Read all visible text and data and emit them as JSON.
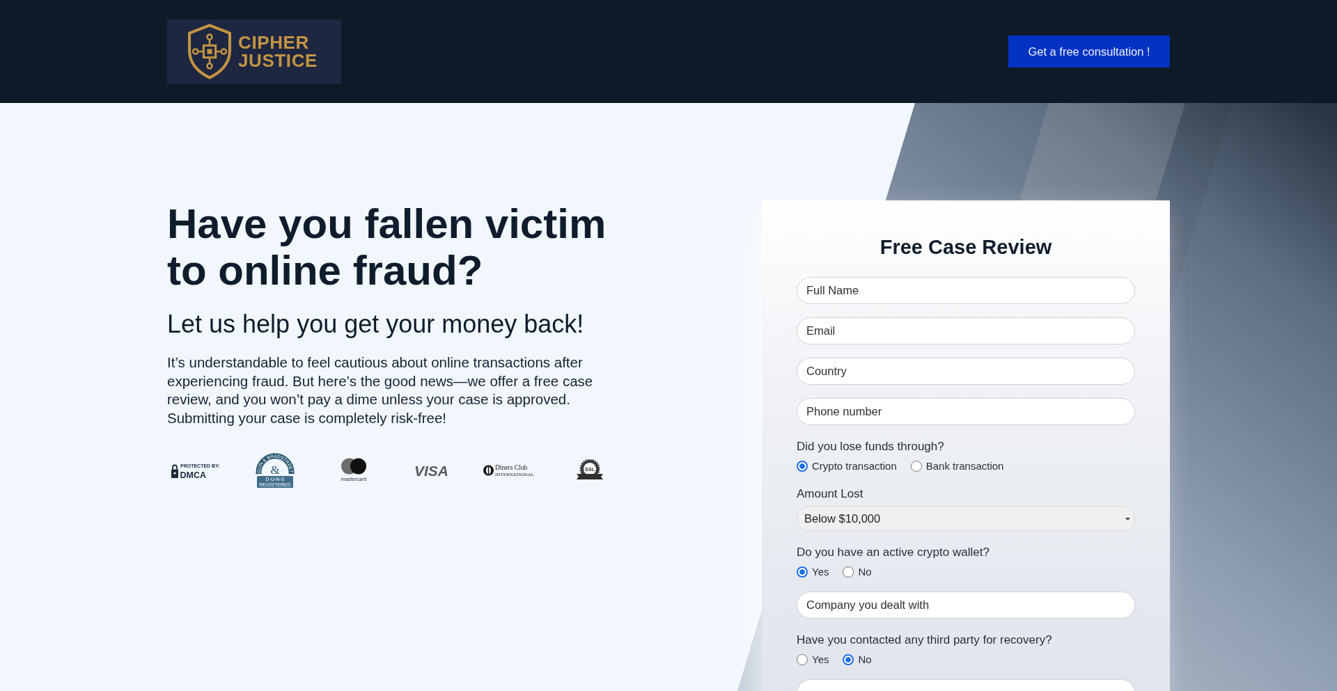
{
  "header": {
    "logo_text": "CIPHER JUSTICE",
    "cta_button": "Get a free consultation !"
  },
  "hero": {
    "heading": "Have you fallen victim to online fraud?",
    "subheading": "Let us help you get your money back!",
    "body": "It’s understandable to feel cautious about online transactions after experiencing fraud. But here’s the good news—we offer a free case review, and you won’t pay a dime unless your case is approved. Submitting your case is completely risk-free!",
    "trust_badges": [
      {
        "kind": "dmca",
        "caption": "PROTECTED BY:",
        "text": "DMCA"
      },
      {
        "kind": "duns",
        "arc_text": "DUN & BRADSTREET",
        "symbol": "&",
        "band_lines": [
          "D-U-N-S",
          "REGISTERED"
        ]
      },
      {
        "kind": "mastercard",
        "text": "mastercard"
      },
      {
        "kind": "visa",
        "text": "VISA"
      },
      {
        "kind": "diners",
        "text": "Diners Club",
        "subtext": "INTERNATIONAL"
      },
      {
        "kind": "ssl",
        "text": "SSL"
      }
    ]
  },
  "form": {
    "title": "Free Case Review",
    "items": [
      {
        "kind": "input",
        "placeholder": "Full Name"
      },
      {
        "kind": "input",
        "placeholder": "Email"
      },
      {
        "kind": "input",
        "placeholder": "Country"
      },
      {
        "kind": "input",
        "placeholder": "Phone number"
      },
      {
        "kind": "radio",
        "label": "Did you lose funds through?",
        "options": [
          {
            "label": "Crypto transaction",
            "selected": true
          },
          {
            "label": "Bank transaction",
            "selected": false
          }
        ]
      },
      {
        "kind": "select",
        "label": "Amount Lost",
        "value": "Below $10,000"
      },
      {
        "kind": "radio",
        "label": "Do you have an active crypto wallet?",
        "options": [
          {
            "label": "Yes",
            "selected": true
          },
          {
            "label": "No",
            "selected": false
          }
        ]
      },
      {
        "kind": "input",
        "placeholder": "Company you dealt with"
      },
      {
        "kind": "radio",
        "label": "Have you contacted any third party for recovery?",
        "options": [
          {
            "label": "Yes",
            "selected": false
          },
          {
            "label": "No",
            "selected": true
          }
        ]
      },
      {
        "kind": "input"
      }
    ]
  }
}
